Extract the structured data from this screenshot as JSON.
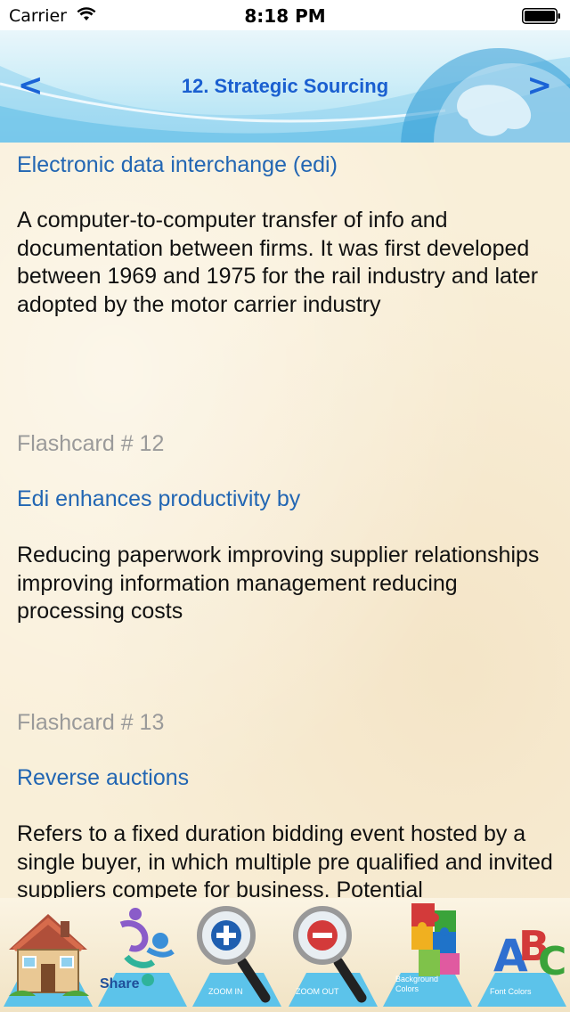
{
  "status_bar": {
    "carrier": "Carrier",
    "time": "8:18 PM"
  },
  "nav": {
    "title": "12. Strategic Sourcing",
    "back_icon": "<",
    "next_icon": ">"
  },
  "cards": [
    {
      "heading": "Electronic data interchange (edi)",
      "body": "A computer-to-computer transfer of info and documentation between firms. It was first developed between 1969 and 1975 for the rail industry and later adopted by the motor carrier industry"
    },
    {
      "label": "Flashcard # 12",
      "heading": "Edi enhances productivity by",
      "body": "Reducing paperwork improving supplier relationships improving information management reducing processing costs"
    },
    {
      "label": "Flashcard # 13",
      "heading": "Reverse auctions",
      "body": "Refers to a fixed duration bidding event hosted by a single buyer, in which multiple pre qualified and invited suppliers compete for business. Potential"
    }
  ],
  "toolbar": {
    "home_icon": "house-icon",
    "share_label": "Share",
    "zoom_in_label": "ZOOM IN",
    "zoom_out_label": "ZOOM OUT",
    "background_label": "Background Colors",
    "font_label": "Font Colors"
  },
  "colors": {
    "heading": "#2266b3",
    "nav_title": "#1a5fd0",
    "label": "#9a9a9a",
    "background": "#f9efd8"
  }
}
